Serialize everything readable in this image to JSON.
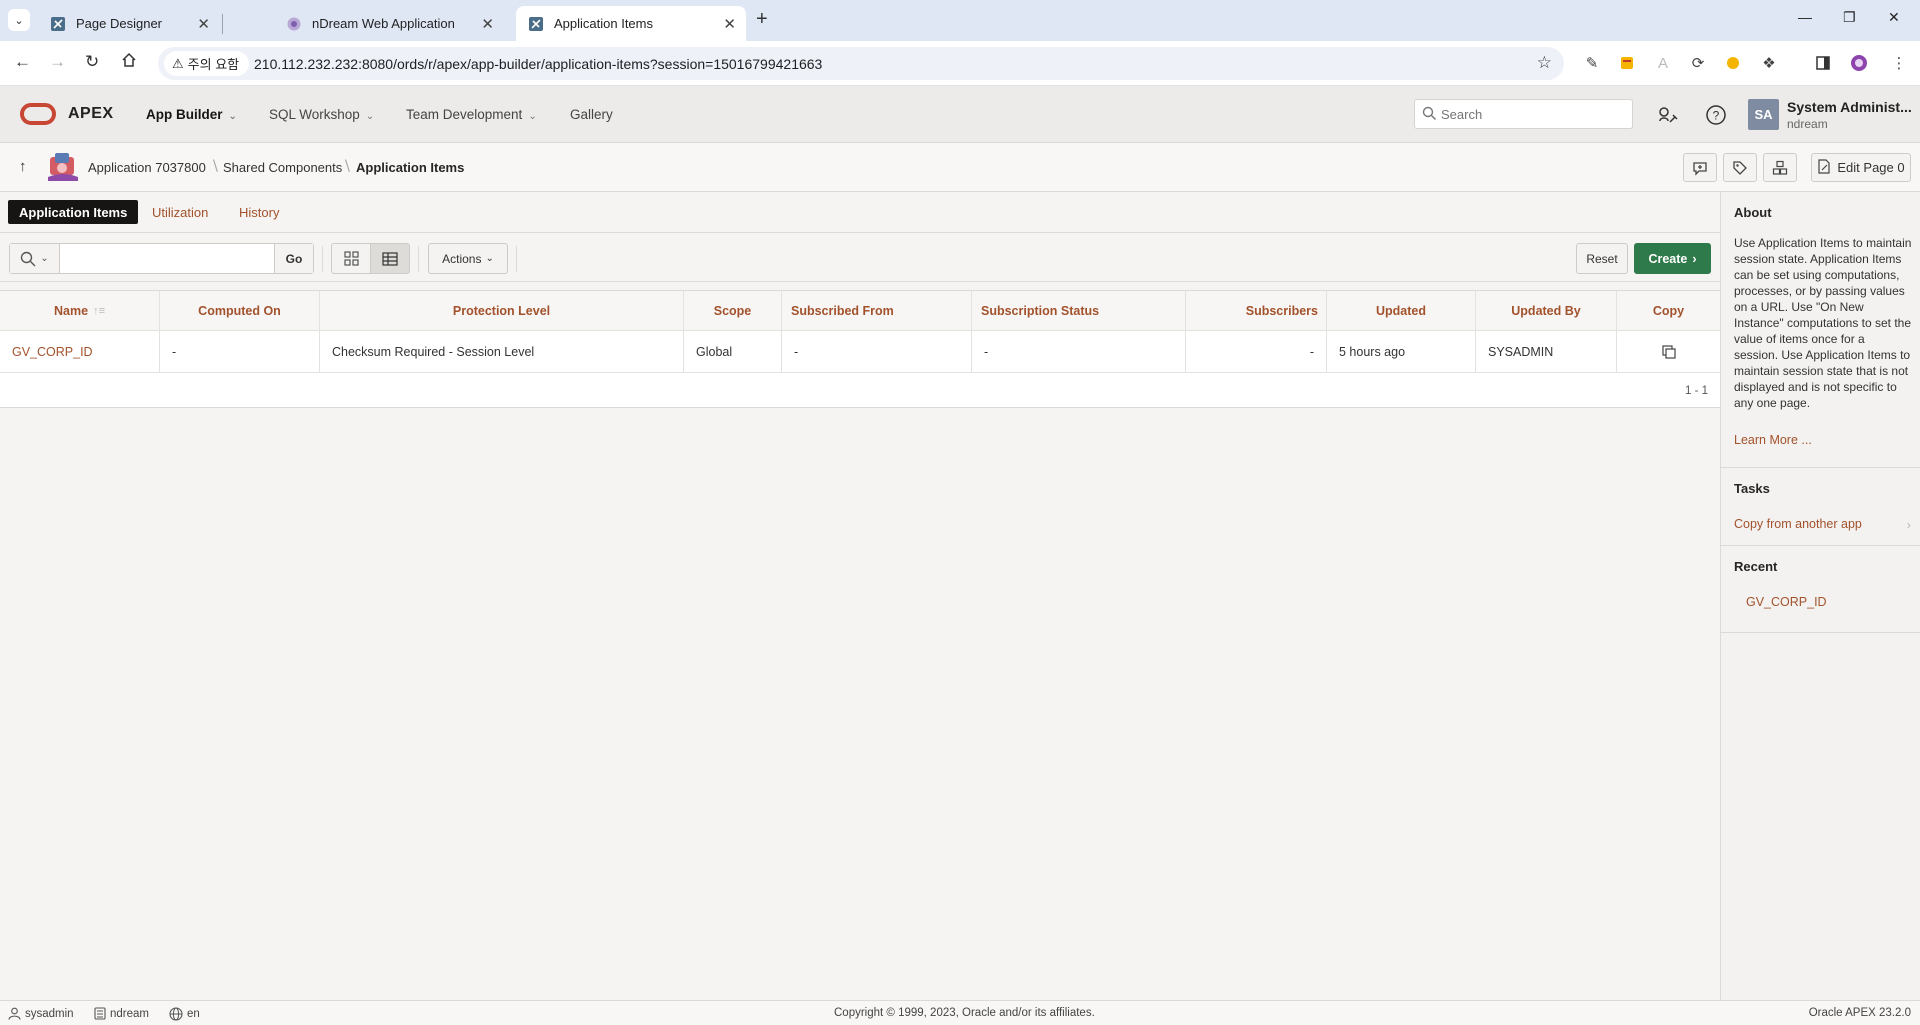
{
  "browser": {
    "tabs": [
      {
        "title": "Page Designer"
      },
      {
        "title": "nDream Web Application"
      },
      {
        "title": "Application Items"
      }
    ],
    "security_chip": "주의 요함",
    "url": "210.112.232.232:8080/ords/r/apex/app-builder/application-items?session=15016799421663"
  },
  "header": {
    "logo": "APEX",
    "menu": [
      {
        "label": "App Builder"
      },
      {
        "label": "SQL Workshop"
      },
      {
        "label": "Team Development"
      },
      {
        "label": "Gallery"
      }
    ],
    "search_placeholder": "Search",
    "avatar_initials": "SA",
    "user_name": "System Administ...",
    "workspace": "ndream"
  },
  "breadcrumb": {
    "items": [
      "Application 7037800",
      "Shared Components",
      "Application Items"
    ],
    "edit_page": "Edit Page 0"
  },
  "page_tabs": [
    "Application Items",
    "Utilization",
    "History"
  ],
  "toolbar": {
    "go": "Go",
    "actions": "Actions",
    "reset": "Reset",
    "create": "Create"
  },
  "report": {
    "columns": [
      "Name",
      "Computed On",
      "Protection Level",
      "Scope",
      "Subscribed From",
      "Subscription Status",
      "Subscribers",
      "Updated",
      "Updated By",
      "Copy"
    ],
    "rows": [
      {
        "name": "GV_CORP_ID",
        "computed_on": "-",
        "protection_level": "Checksum Required - Session Level",
        "scope": "Global",
        "subscribed_from": "-",
        "subscription_status": "-",
        "subscribers": "-",
        "updated": "5 hours ago",
        "updated_by": "SYSADMIN"
      }
    ],
    "pagination": "1 - 1"
  },
  "sidebar": {
    "about_title": "About",
    "about_text": "Use Application Items to maintain session state. Application Items can be set using computations, processes, or by passing values on a URL. Use \"On New Instance\" computations to set the value of items once for a session. Use Application Items to maintain session state that is not displayed and is not specific to any one page.",
    "learn_more": "Learn More ...",
    "tasks_title": "Tasks",
    "tasks": [
      "Copy from another app"
    ],
    "recent_title": "Recent",
    "recent": [
      "GV_CORP_ID"
    ]
  },
  "footer": {
    "user": "sysadmin",
    "workspace": "ndream",
    "language": "en",
    "copyright": "Copyright © 1999, 2023, Oracle and/or its affiliates.",
    "version": "Oracle APEX 23.2.0"
  },
  "colors": {
    "accent_link": "#a2522c",
    "create_button": "#2f7a4b",
    "oracle_red": "#c74634",
    "active_tab": "#161513"
  }
}
